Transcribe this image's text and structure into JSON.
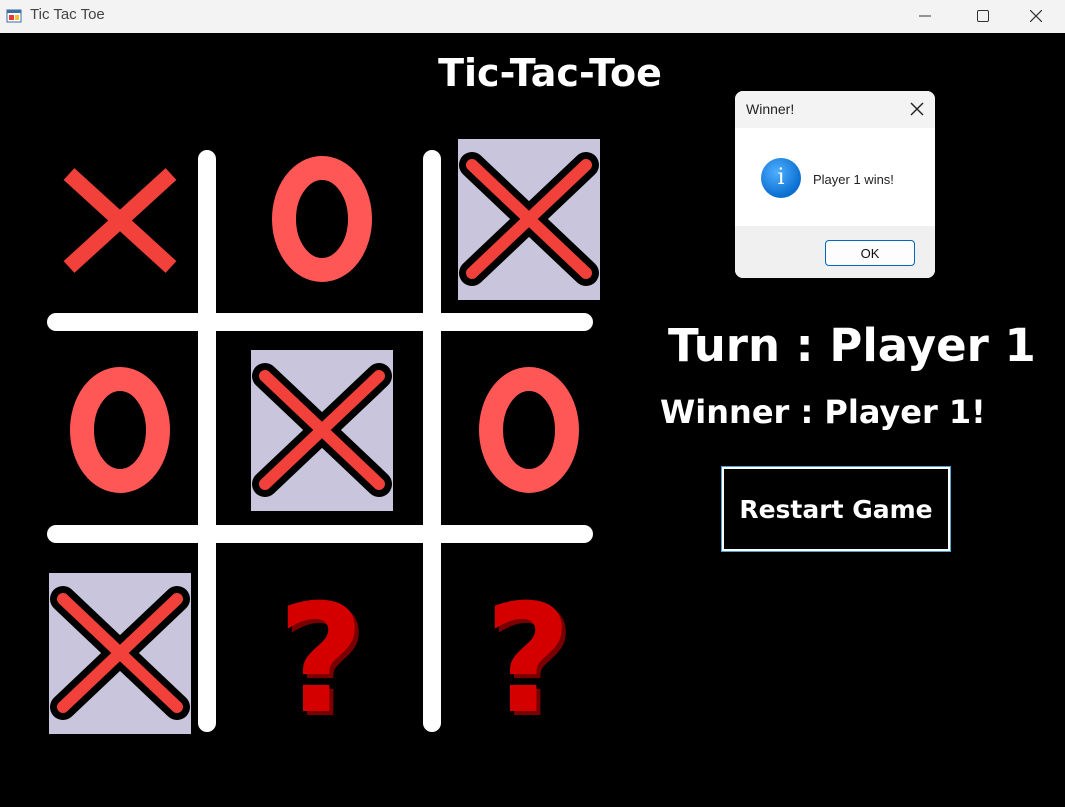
{
  "window": {
    "title": "Tic Tac Toe"
  },
  "game": {
    "title": "Tic-Tac-Toe",
    "turn_label": "Turn : Player 1",
    "winner_label": "Winner :  Player 1!",
    "restart_label": "Restart Game"
  },
  "board": {
    "cells": [
      "X",
      "O",
      "X-highlight",
      "O",
      "X-highlight",
      "O",
      "X-highlight",
      "?",
      "?"
    ]
  },
  "dialog": {
    "title": "Winner!",
    "message": "Player 1 wins!",
    "ok_label": "OK",
    "icon": "information-icon"
  },
  "colors": {
    "background": "#000000",
    "mark_red": "#ff5656",
    "x_red": "#f2413a",
    "highlight": "#c8c5dc",
    "question_red": "#d40000"
  }
}
